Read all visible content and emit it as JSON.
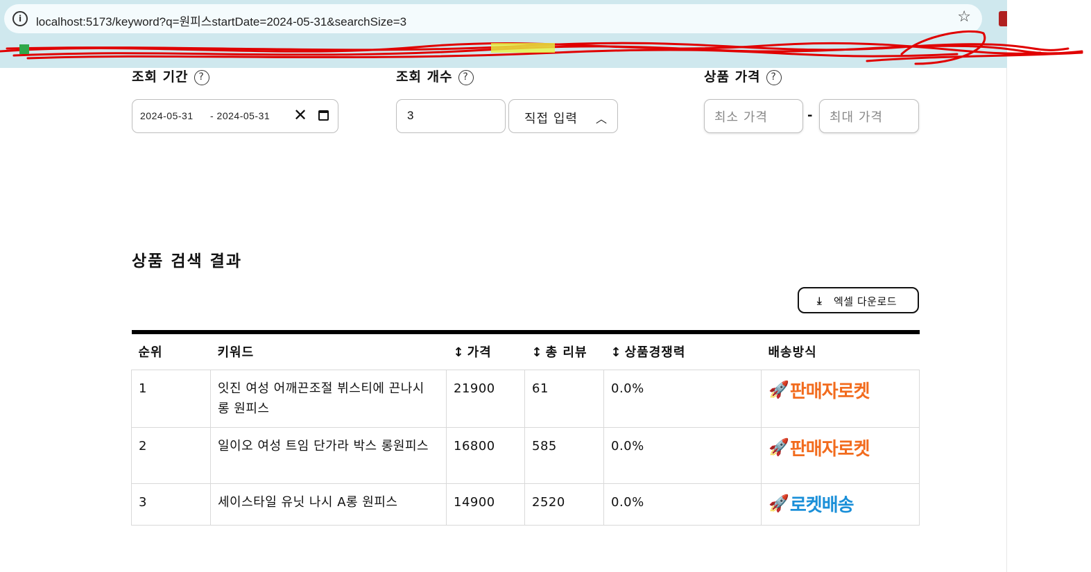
{
  "browser": {
    "url": "localhost:5173/keyword?q=원피스startDate=2024-05-31&searchSize=3",
    "site_info_icon": "info-icon",
    "bookmark_icon": "star-icon"
  },
  "filters": {
    "period": {
      "label": "조회 기간",
      "help": "?",
      "start_date": "2024-05-31",
      "end_date": "- 2024-05-31"
    },
    "count": {
      "label": "조회 개수",
      "help": "?",
      "value": "3",
      "direct_input_label": "직접 입력"
    },
    "price": {
      "label": "상품 가격",
      "help": "?",
      "min_placeholder": "최소 가격",
      "max_placeholder": "최대 가격",
      "separator": "-"
    }
  },
  "results": {
    "title": "상품 검색 결과",
    "excel_button": "엑셀 다운로드",
    "columns": [
      "순위",
      "키워드",
      "가격",
      "총 리뷰",
      "상품경쟁력",
      "배송방식"
    ],
    "rows": [
      {
        "rank": "1",
        "keyword": "잇진 여성 어깨끈조절 뷔스티에 끈나시 롱 원피스",
        "price": "21900",
        "reviews": "61",
        "competitiveness": "0.0%",
        "delivery": "판매자로켓",
        "delivery_type": "seller-rocket"
      },
      {
        "rank": "2",
        "keyword": "일이오 여성 트임 단가라 박스 롱원피스",
        "price": "16800",
        "reviews": "585",
        "competitiveness": "0.0%",
        "delivery": "판매자로켓",
        "delivery_type": "seller-rocket"
      },
      {
        "rank": "3",
        "keyword": "세이스타일 유닛 나시 A롱 원피스",
        "price": "14900",
        "reviews": "2520",
        "competitiveness": "0.0%",
        "delivery": "로켓배송",
        "delivery_type": "rocket"
      }
    ]
  },
  "colors": {
    "seller_rocket": "#f26b1d",
    "rocket_delivery": "#1a8fd8",
    "chrome_bg": "#cfe8ee",
    "redaction": "#e00000"
  }
}
